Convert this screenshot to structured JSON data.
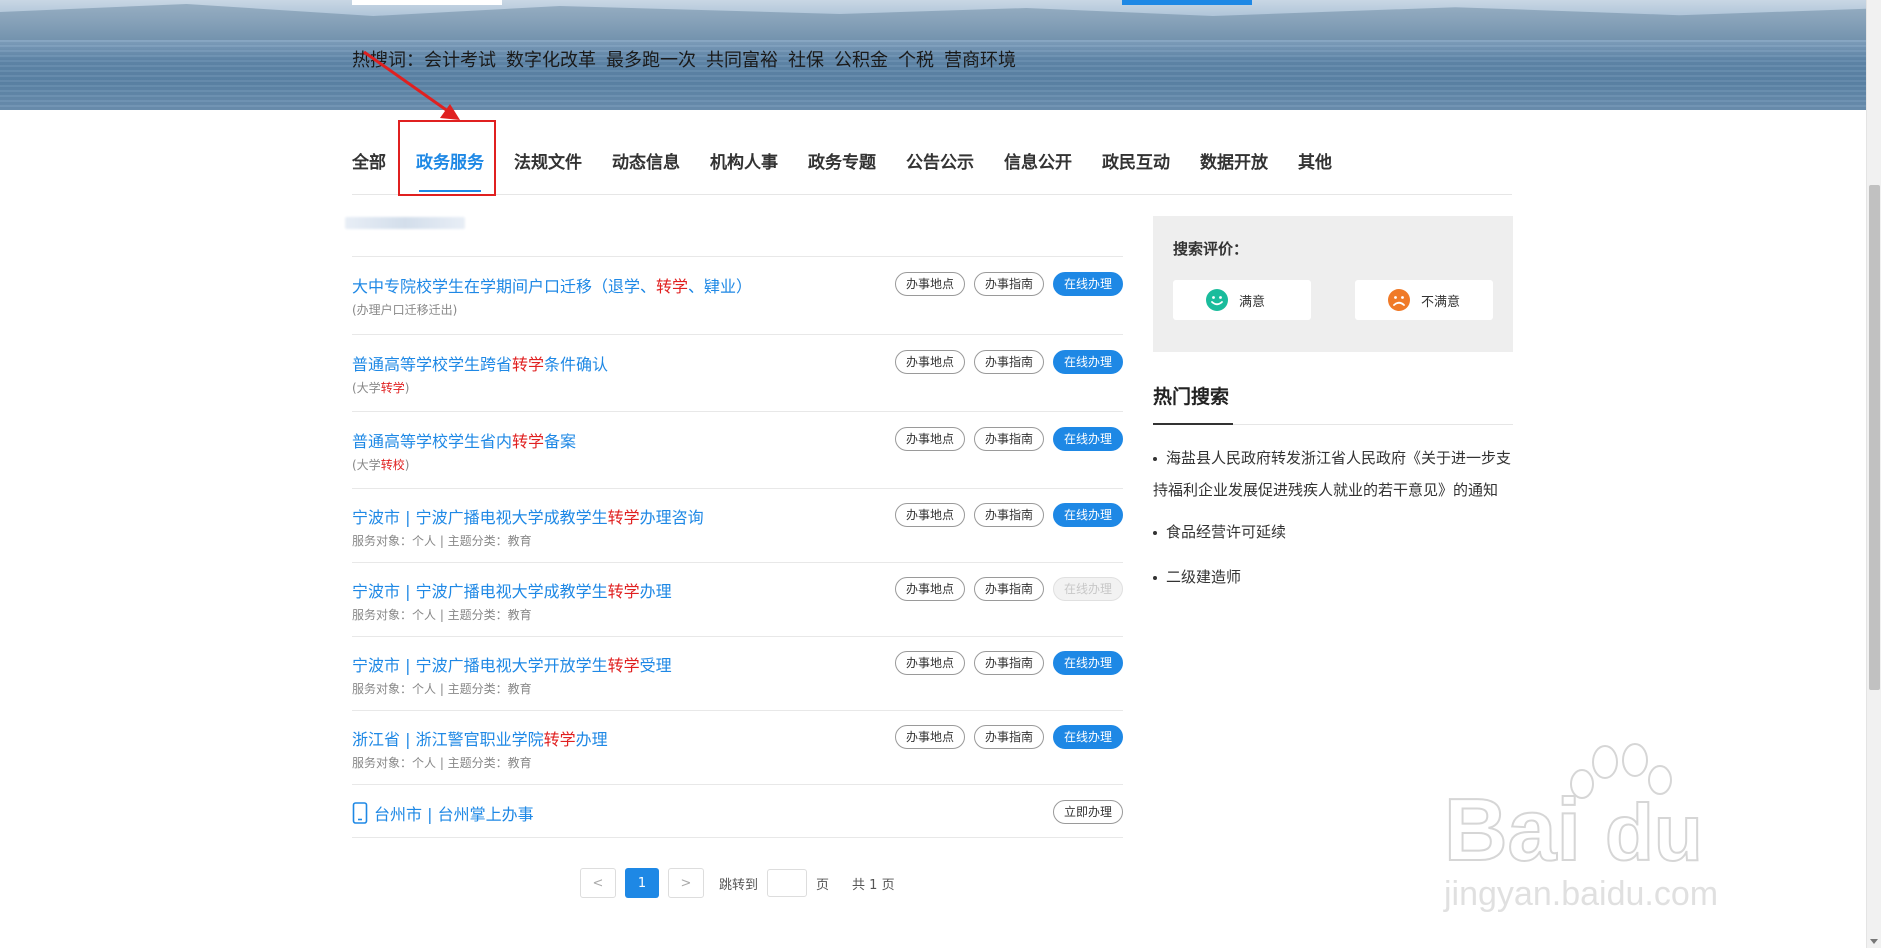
{
  "banner": {
    "hot_label": "热搜词：",
    "hot_words": [
      "会计考试",
      "数字化改革",
      "最多跑一次",
      "共同富裕",
      "社保",
      "公积金",
      "个税",
      "营商环境"
    ]
  },
  "tabs": [
    "全部",
    "政务服务",
    "法规文件",
    "动态信息",
    "机构人事",
    "政务专题",
    "公告公示",
    "信息公开",
    "政民互动",
    "数据开放",
    "其他"
  ],
  "active_tab": "政务服务",
  "results": [
    {
      "title_pre": "大中专院校学生在学期间户口迁移（退学、",
      "title_hl": "转学",
      "title_post": "、肄业）",
      "sub_pre": "(办理户口迁移迁出)",
      "sub_hl": "",
      "sub_post": "",
      "btn1": "办事地点",
      "btn2": "办事指南",
      "btn3": "在线办理"
    },
    {
      "title_pre": "普通高等学校学生跨省",
      "title_hl": "转学",
      "title_post": "条件确认",
      "sub_pre": "(大学",
      "sub_hl": "转学",
      "sub_post": ")",
      "btn1": "办事地点",
      "btn2": "办事指南",
      "btn3": "在线办理"
    },
    {
      "title_pre": "普通高等学校学生省内",
      "title_hl": "转学",
      "title_post": "备案",
      "sub_pre": "(大学",
      "sub_hl": "转校",
      "sub_post": ")",
      "btn1": "办事地点",
      "btn2": "办事指南",
      "btn3": "在线办理"
    },
    {
      "title_pre": "宁波市 | 宁波广播电视大学成教学生",
      "title_hl": "转学",
      "title_post": "办理咨询",
      "sub_pre": "服务对象：个人  |  主题分类：教育",
      "sub_hl": "",
      "sub_post": "",
      "btn1": "办事地点",
      "btn2": "办事指南",
      "btn3": "在线办理"
    },
    {
      "title_pre": "宁波市 | 宁波广播电视大学成教学生",
      "title_hl": "转学",
      "title_post": "办理",
      "sub_pre": "服务对象：个人  |  主题分类：教育",
      "sub_hl": "",
      "sub_post": "",
      "btn1": "办事地点",
      "btn2": "办事指南",
      "btn3": "在线办理"
    },
    {
      "title_pre": "宁波市 | 宁波广播电视大学开放学生",
      "title_hl": "转学",
      "title_post": "受理",
      "sub_pre": "服务对象：个人  |  主题分类：教育",
      "sub_hl": "",
      "sub_post": "",
      "btn1": "办事地点",
      "btn2": "办事指南",
      "btn3": "在线办理"
    },
    {
      "title_pre": "浙江省 | 浙江警官职业学院",
      "title_hl": "转学",
      "title_post": "办理",
      "sub_pre": "服务对象：个人  |  主题分类：教育",
      "sub_hl": "",
      "sub_post": "",
      "btn1": "办事地点",
      "btn2": "办事指南",
      "btn3": "在线办理"
    }
  ],
  "mobile_result": {
    "title": "台州市 | 台州掌上办事",
    "button": "立即办理",
    "icon": "phone-icon"
  },
  "pagination": {
    "prev": "<",
    "current": "1",
    "next": ">",
    "jump_label": "跳转到",
    "page_unit": "页",
    "total": "共 1 页"
  },
  "evaluation": {
    "label": "搜索评价：",
    "satisfied": "满意",
    "unsatisfied": "不满意"
  },
  "hot_search": {
    "title": "热门搜索",
    "items": [
      "海盐县人民政府转发浙江省人民政府《关于进一步支持福利企业发展促进残疾人就业的若干意见》的通知",
      "食品经营许可延续",
      "二级建造师"
    ]
  },
  "watermark": {
    "brand": "Baidu经验",
    "url": "jingyan.baidu.com"
  },
  "colors": {
    "accent": "#1e88e5",
    "highlight": "#e02020",
    "satisfied_icon": "#1abc9c",
    "unsatisfied_icon": "#f07a28"
  }
}
